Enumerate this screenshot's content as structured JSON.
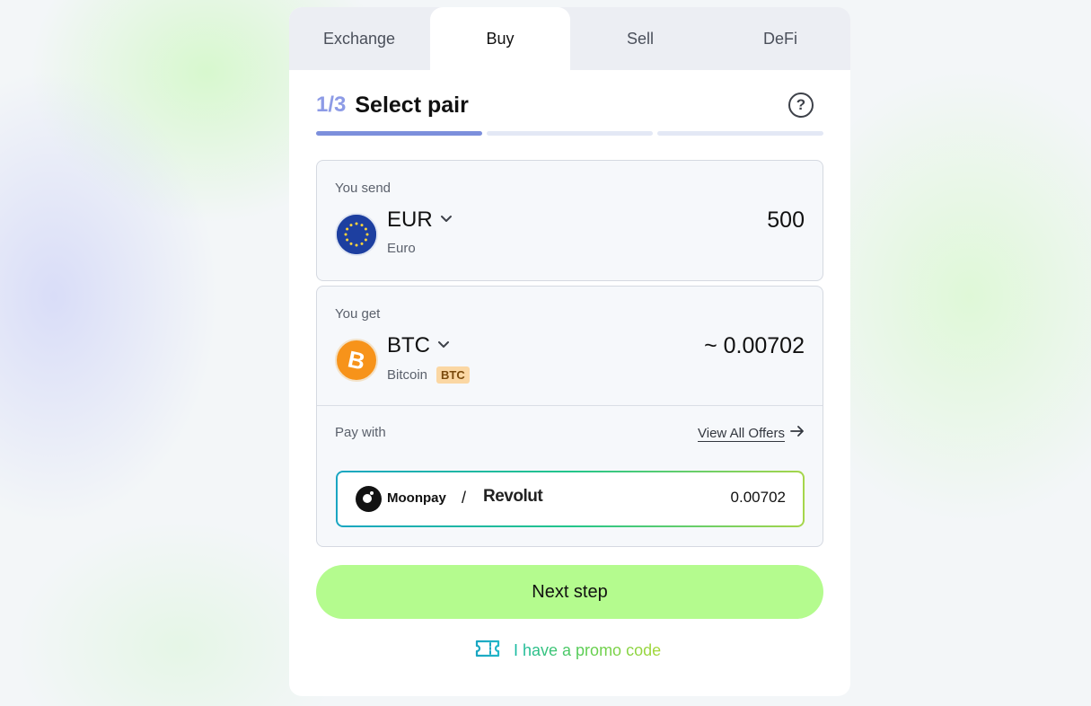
{
  "tabs": [
    {
      "label": "Exchange",
      "active": false
    },
    {
      "label": "Buy",
      "active": true
    },
    {
      "label": "Sell",
      "active": false
    },
    {
      "label": "DeFi",
      "active": false
    }
  ],
  "step": {
    "number": "1/3",
    "title": "Select pair",
    "help_icon": "question-circle-icon",
    "progress": {
      "current": 1,
      "total": 3
    }
  },
  "send": {
    "label": "You send",
    "currency_code": "EUR",
    "currency_name": "Euro",
    "amount": "500",
    "icon": "eu-flag-icon"
  },
  "get": {
    "label": "You get",
    "currency_code": "BTC",
    "currency_name": "Bitcoin",
    "ticker_badge": "BTC",
    "amount": "~ 0.00702",
    "icon": "bitcoin-icon"
  },
  "pay_with": {
    "label": "Pay with",
    "view_all_label": "View All Offers",
    "offer": {
      "provider": "Moonpay",
      "separator": "/",
      "method": "Revolut",
      "amount": "0.00702"
    }
  },
  "next_button": {
    "label": "Next step",
    "color": "#b4fb8e"
  },
  "promo": {
    "label": "I have a promo code",
    "icon": "ticket-icon"
  },
  "colors": {
    "accent": "#7c8fdc",
    "button": "#b4fb8e",
    "badge": "#fbd7a3",
    "bitcoin": "#f7931a"
  }
}
